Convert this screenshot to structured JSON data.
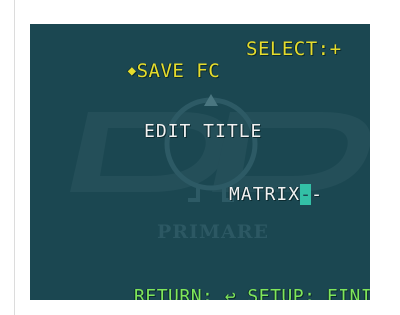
{
  "osd": {
    "save_marker": "◆",
    "save_label": "SAVE FC",
    "select_hint": "SELECT:+",
    "heading": "EDIT TITLE",
    "title_text": "MATRIX",
    "cursor_char": "-",
    "title_trailing": "-",
    "footer_return": "RETURN:",
    "footer_return_icon": "↩",
    "footer_setup": "SETUP: FINISH"
  },
  "watermark": {
    "logo_text": "DVD",
    "brand_text": "PRIMARE"
  },
  "colors": {
    "background": "#1b4751",
    "header_text": "#e6dc2c",
    "body_text": "#f2f2f2",
    "footer_text": "#7fe65a",
    "cursor": "#33c0a6",
    "watermark": "#2a5661"
  },
  "icons": {
    "save_marker": "diamond-icon",
    "return": "return-arrow-icon"
  }
}
